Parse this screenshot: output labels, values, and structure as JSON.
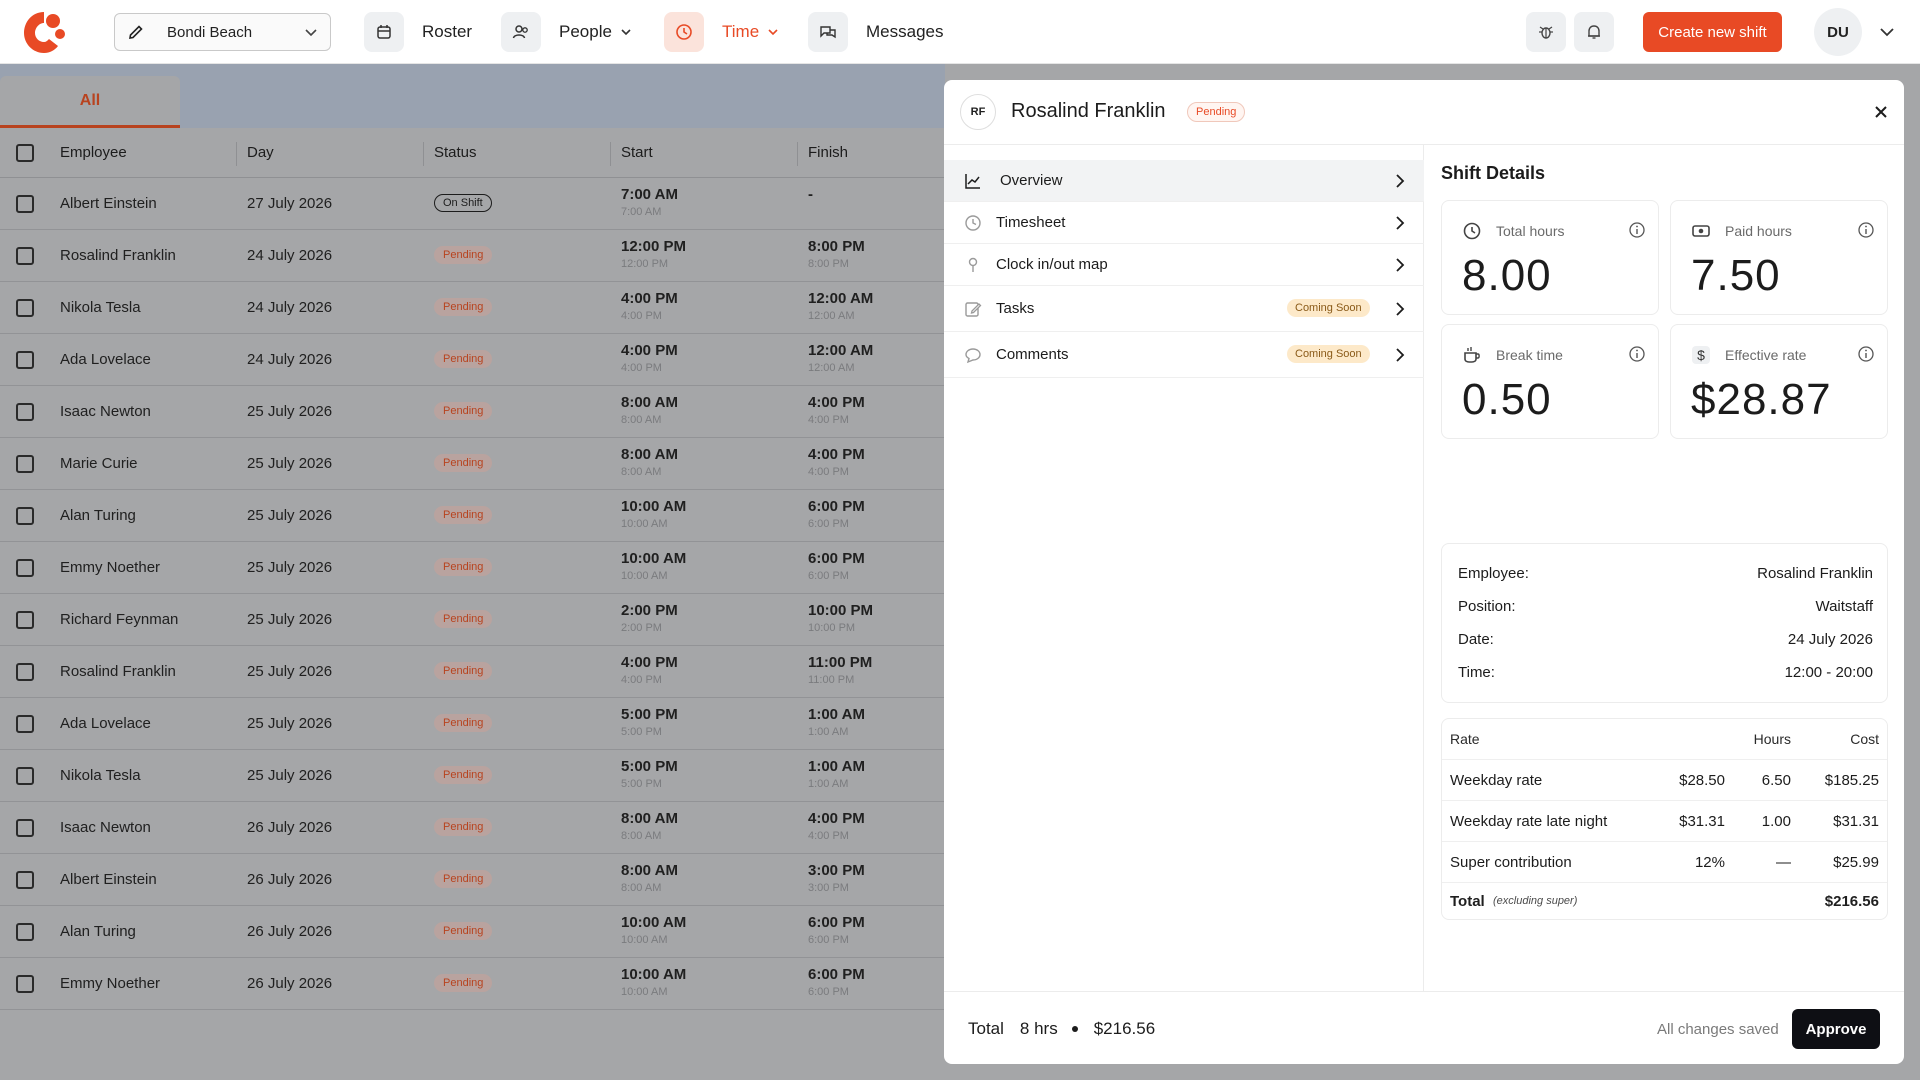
{
  "header": {
    "location": "Bondi Beach",
    "nav": {
      "roster": "Roster",
      "people": "People",
      "time": "Time",
      "messages": "Messages"
    },
    "create_button": "Create new shift",
    "user_initials": "DU"
  },
  "list": {
    "tab_all": "All",
    "columns": {
      "employee": "Employee",
      "day": "Day",
      "status": "Status",
      "start": "Start",
      "finish": "Finish"
    },
    "rows": [
      {
        "employee": "Albert Einstein",
        "day": "27 July 2026",
        "status": "On Shift",
        "start": "7:00 AM",
        "start_sub": "7:00 AM",
        "finish": "-",
        "finish_sub": ""
      },
      {
        "employee": "Rosalind Franklin",
        "day": "24 July 2026",
        "status": "Pending",
        "start": "12:00 PM",
        "start_sub": "12:00 PM",
        "finish": "8:00 PM",
        "finish_sub": "8:00 PM"
      },
      {
        "employee": "Nikola Tesla",
        "day": "24 July 2026",
        "status": "Pending",
        "start": "4:00 PM",
        "start_sub": "4:00 PM",
        "finish": "12:00 AM",
        "finish_sub": "12:00 AM"
      },
      {
        "employee": "Ada Lovelace",
        "day": "24 July 2026",
        "status": "Pending",
        "start": "4:00 PM",
        "start_sub": "4:00 PM",
        "finish": "12:00 AM",
        "finish_sub": "12:00 AM"
      },
      {
        "employee": "Isaac Newton",
        "day": "25 July 2026",
        "status": "Pending",
        "start": "8:00 AM",
        "start_sub": "8:00 AM",
        "finish": "4:00 PM",
        "finish_sub": "4:00 PM"
      },
      {
        "employee": "Marie Curie",
        "day": "25 July 2026",
        "status": "Pending",
        "start": "8:00 AM",
        "start_sub": "8:00 AM",
        "finish": "4:00 PM",
        "finish_sub": "4:00 PM"
      },
      {
        "employee": "Alan Turing",
        "day": "25 July 2026",
        "status": "Pending",
        "start": "10:00 AM",
        "start_sub": "10:00 AM",
        "finish": "6:00 PM",
        "finish_sub": "6:00 PM"
      },
      {
        "employee": "Emmy Noether",
        "day": "25 July 2026",
        "status": "Pending",
        "start": "10:00 AM",
        "start_sub": "10:00 AM",
        "finish": "6:00 PM",
        "finish_sub": "6:00 PM"
      },
      {
        "employee": "Richard Feynman",
        "day": "25 July 2026",
        "status": "Pending",
        "start": "2:00 PM",
        "start_sub": "2:00 PM",
        "finish": "10:00 PM",
        "finish_sub": "10:00 PM"
      },
      {
        "employee": "Rosalind Franklin",
        "day": "25 July 2026",
        "status": "Pending",
        "start": "4:00 PM",
        "start_sub": "4:00 PM",
        "finish": "11:00 PM",
        "finish_sub": "11:00 PM"
      },
      {
        "employee": "Ada Lovelace",
        "day": "25 July 2026",
        "status": "Pending",
        "start": "5:00 PM",
        "start_sub": "5:00 PM",
        "finish": "1:00 AM",
        "finish_sub": "1:00 AM"
      },
      {
        "employee": "Nikola Tesla",
        "day": "25 July 2026",
        "status": "Pending",
        "start": "5:00 PM",
        "start_sub": "5:00 PM",
        "finish": "1:00 AM",
        "finish_sub": "1:00 AM"
      },
      {
        "employee": "Isaac Newton",
        "day": "26 July 2026",
        "status": "Pending",
        "start": "8:00 AM",
        "start_sub": "8:00 AM",
        "finish": "4:00 PM",
        "finish_sub": "4:00 PM"
      },
      {
        "employee": "Albert Einstein",
        "day": "26 July 2026",
        "status": "Pending",
        "start": "8:00 AM",
        "start_sub": "8:00 AM",
        "finish": "3:00 PM",
        "finish_sub": "3:00 PM"
      },
      {
        "employee": "Alan Turing",
        "day": "26 July 2026",
        "status": "Pending",
        "start": "10:00 AM",
        "start_sub": "10:00 AM",
        "finish": "6:00 PM",
        "finish_sub": "6:00 PM"
      },
      {
        "employee": "Emmy Noether",
        "day": "26 July 2026",
        "status": "Pending",
        "start": "10:00 AM",
        "start_sub": "10:00 AM",
        "finish": "6:00 PM",
        "finish_sub": "6:00 PM"
      }
    ]
  },
  "panel": {
    "initials": "RF",
    "name": "Rosalind Franklin",
    "status": "Pending",
    "menu": [
      {
        "label": "Overview",
        "icon": "chart-line-icon",
        "soon": ""
      },
      {
        "label": "Timesheet",
        "icon": "clock-icon",
        "soon": ""
      },
      {
        "label": "Clock in/out map",
        "icon": "map-pin-icon",
        "soon": ""
      },
      {
        "label": "Tasks",
        "icon": "edit-icon",
        "soon": "Coming Soon"
      },
      {
        "label": "Comments",
        "icon": "comment-icon",
        "soon": "Coming Soon"
      }
    ],
    "details": {
      "title": "Shift Details",
      "stats": {
        "total_hours": {
          "label": "Total hours",
          "value": "8.00"
        },
        "paid_hours": {
          "label": "Paid hours",
          "value": "7.50"
        },
        "break_time": {
          "label": "Break time",
          "value": "0.50"
        },
        "effective_rate": {
          "label": "Effective rate",
          "value": "$28.87"
        }
      },
      "info": {
        "employee_label": "Employee:",
        "employee": "Rosalind Franklin",
        "position_label": "Position:",
        "position": "Waitstaff",
        "date_label": "Date:",
        "date": "24 July 2026",
        "time_label": "Time:",
        "time": "12:00 - 20:00"
      },
      "costs": {
        "head": {
          "rate": "Rate",
          "hours": "Hours",
          "cost": "Cost"
        },
        "rows": [
          {
            "rate": "Weekday rate",
            "amount": "$28.50",
            "hours": "6.50",
            "cost": "$185.25"
          },
          {
            "rate": "Weekday rate late night",
            "amount": "$31.31",
            "hours": "1.00",
            "cost": "$31.31"
          },
          {
            "rate": "Super contribution",
            "amount": "12%",
            "hours": "—",
            "cost": "$25.99"
          }
        ],
        "total_label": "Total",
        "total_note": "(excluding super)",
        "total_value": "$216.56"
      }
    },
    "footer": {
      "total_label": "Total",
      "hours": "8 hrs",
      "cost": "$216.56",
      "saved": "All changes saved",
      "approve": "Approve"
    }
  },
  "colors": {
    "accent": "#e84a25",
    "approve": "#0e0f14",
    "overlay": "#a5a6a8"
  }
}
